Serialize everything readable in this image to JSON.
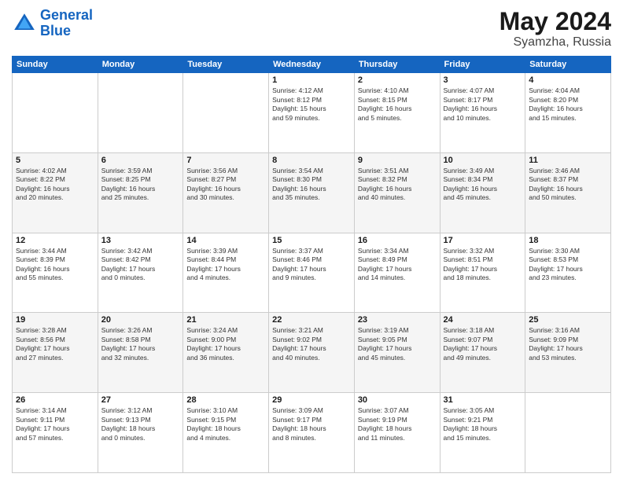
{
  "header": {
    "logo_line1": "General",
    "logo_line2": "Blue",
    "month_year": "May 2024",
    "location": "Syamzha, Russia"
  },
  "days_of_week": [
    "Sunday",
    "Monday",
    "Tuesday",
    "Wednesday",
    "Thursday",
    "Friday",
    "Saturday"
  ],
  "weeks": [
    [
      {
        "day": "",
        "info": ""
      },
      {
        "day": "",
        "info": ""
      },
      {
        "day": "",
        "info": ""
      },
      {
        "day": "1",
        "info": "Sunrise: 4:12 AM\nSunset: 8:12 PM\nDaylight: 15 hours\nand 59 minutes."
      },
      {
        "day": "2",
        "info": "Sunrise: 4:10 AM\nSunset: 8:15 PM\nDaylight: 16 hours\nand 5 minutes."
      },
      {
        "day": "3",
        "info": "Sunrise: 4:07 AM\nSunset: 8:17 PM\nDaylight: 16 hours\nand 10 minutes."
      },
      {
        "day": "4",
        "info": "Sunrise: 4:04 AM\nSunset: 8:20 PM\nDaylight: 16 hours\nand 15 minutes."
      }
    ],
    [
      {
        "day": "5",
        "info": "Sunrise: 4:02 AM\nSunset: 8:22 PM\nDaylight: 16 hours\nand 20 minutes."
      },
      {
        "day": "6",
        "info": "Sunrise: 3:59 AM\nSunset: 8:25 PM\nDaylight: 16 hours\nand 25 minutes."
      },
      {
        "day": "7",
        "info": "Sunrise: 3:56 AM\nSunset: 8:27 PM\nDaylight: 16 hours\nand 30 minutes."
      },
      {
        "day": "8",
        "info": "Sunrise: 3:54 AM\nSunset: 8:30 PM\nDaylight: 16 hours\nand 35 minutes."
      },
      {
        "day": "9",
        "info": "Sunrise: 3:51 AM\nSunset: 8:32 PM\nDaylight: 16 hours\nand 40 minutes."
      },
      {
        "day": "10",
        "info": "Sunrise: 3:49 AM\nSunset: 8:34 PM\nDaylight: 16 hours\nand 45 minutes."
      },
      {
        "day": "11",
        "info": "Sunrise: 3:46 AM\nSunset: 8:37 PM\nDaylight: 16 hours\nand 50 minutes."
      }
    ],
    [
      {
        "day": "12",
        "info": "Sunrise: 3:44 AM\nSunset: 8:39 PM\nDaylight: 16 hours\nand 55 minutes."
      },
      {
        "day": "13",
        "info": "Sunrise: 3:42 AM\nSunset: 8:42 PM\nDaylight: 17 hours\nand 0 minutes."
      },
      {
        "day": "14",
        "info": "Sunrise: 3:39 AM\nSunset: 8:44 PM\nDaylight: 17 hours\nand 4 minutes."
      },
      {
        "day": "15",
        "info": "Sunrise: 3:37 AM\nSunset: 8:46 PM\nDaylight: 17 hours\nand 9 minutes."
      },
      {
        "day": "16",
        "info": "Sunrise: 3:34 AM\nSunset: 8:49 PM\nDaylight: 17 hours\nand 14 minutes."
      },
      {
        "day": "17",
        "info": "Sunrise: 3:32 AM\nSunset: 8:51 PM\nDaylight: 17 hours\nand 18 minutes."
      },
      {
        "day": "18",
        "info": "Sunrise: 3:30 AM\nSunset: 8:53 PM\nDaylight: 17 hours\nand 23 minutes."
      }
    ],
    [
      {
        "day": "19",
        "info": "Sunrise: 3:28 AM\nSunset: 8:56 PM\nDaylight: 17 hours\nand 27 minutes."
      },
      {
        "day": "20",
        "info": "Sunrise: 3:26 AM\nSunset: 8:58 PM\nDaylight: 17 hours\nand 32 minutes."
      },
      {
        "day": "21",
        "info": "Sunrise: 3:24 AM\nSunset: 9:00 PM\nDaylight: 17 hours\nand 36 minutes."
      },
      {
        "day": "22",
        "info": "Sunrise: 3:21 AM\nSunset: 9:02 PM\nDaylight: 17 hours\nand 40 minutes."
      },
      {
        "day": "23",
        "info": "Sunrise: 3:19 AM\nSunset: 9:05 PM\nDaylight: 17 hours\nand 45 minutes."
      },
      {
        "day": "24",
        "info": "Sunrise: 3:18 AM\nSunset: 9:07 PM\nDaylight: 17 hours\nand 49 minutes."
      },
      {
        "day": "25",
        "info": "Sunrise: 3:16 AM\nSunset: 9:09 PM\nDaylight: 17 hours\nand 53 minutes."
      }
    ],
    [
      {
        "day": "26",
        "info": "Sunrise: 3:14 AM\nSunset: 9:11 PM\nDaylight: 17 hours\nand 57 minutes."
      },
      {
        "day": "27",
        "info": "Sunrise: 3:12 AM\nSunset: 9:13 PM\nDaylight: 18 hours\nand 0 minutes."
      },
      {
        "day": "28",
        "info": "Sunrise: 3:10 AM\nSunset: 9:15 PM\nDaylight: 18 hours\nand 4 minutes."
      },
      {
        "day": "29",
        "info": "Sunrise: 3:09 AM\nSunset: 9:17 PM\nDaylight: 18 hours\nand 8 minutes."
      },
      {
        "day": "30",
        "info": "Sunrise: 3:07 AM\nSunset: 9:19 PM\nDaylight: 18 hours\nand 11 minutes."
      },
      {
        "day": "31",
        "info": "Sunrise: 3:05 AM\nSunset: 9:21 PM\nDaylight: 18 hours\nand 15 minutes."
      },
      {
        "day": "",
        "info": ""
      }
    ]
  ]
}
